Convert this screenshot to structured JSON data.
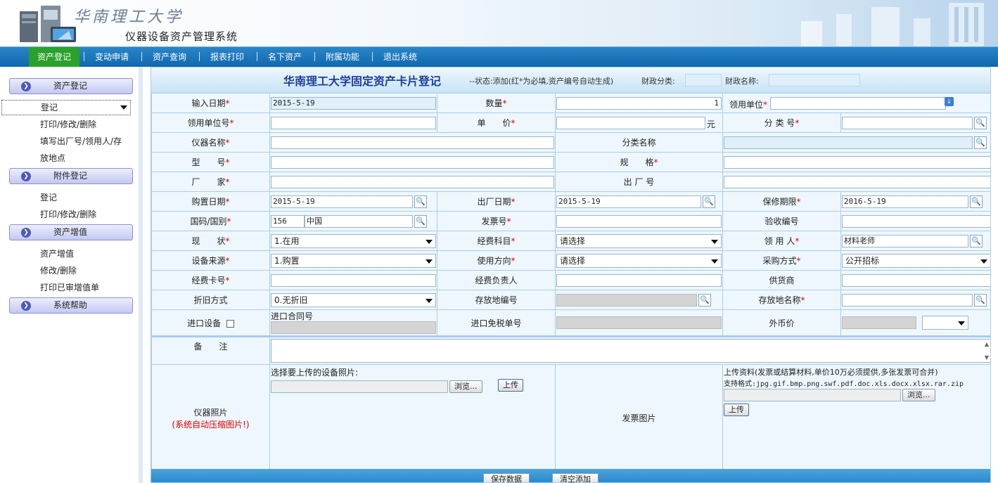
{
  "header": {
    "calligraphy": "华南理工大学",
    "system_title": "仪器设备资产管理系统"
  },
  "nav": {
    "items": [
      "资产登记",
      "变动申请",
      "资产查询",
      "报表打印",
      "名下资产",
      "附属功能",
      "退出系统"
    ],
    "active_color": "#2aa12a",
    "bar_color": "#1a76bb"
  },
  "sidebar": {
    "sections": [
      {
        "title": "资产登记",
        "links": [
          "登记",
          "打印/修改/删除",
          "填写出厂号/领用人/存",
          "放地点"
        ]
      },
      {
        "title": "附件登记",
        "links": [
          "登记",
          "打印/修改/删除"
        ]
      },
      {
        "title": "资产增值",
        "links": [
          "资产增值",
          "修改/删除",
          "打印已审增值单"
        ]
      },
      {
        "title": "系统帮助",
        "links": []
      }
    ]
  },
  "form": {
    "title": "华南理工大学固定资产卡片登记",
    "subtitle": "--状态:添加(红*为必填,资产编号自动生成)",
    "fin_category_label": "财政分类:",
    "fin_name_label": "财政名称:",
    "required_mark": "*",
    "labels": {
      "input_date": "输入日期",
      "quantity": "数量",
      "dept": "领用单位",
      "dept_no": "领用单位号",
      "unit_price": "单　　价",
      "category_no": "分 类 号",
      "instrument_name": "仪器名称",
      "category_name": "分类名称",
      "model": "型　　号",
      "spec": "规　　格",
      "manufacturer": "厂　　家",
      "factory_no": "出 厂 号",
      "purchase_date": "购置日期",
      "factory_date": "出厂日期",
      "warranty": "保修期限",
      "country": "国码/国别",
      "invoice_no": "发票号",
      "acceptance_no": "验收编号",
      "status": "现　　状",
      "fund_subject": "经费科目",
      "user": "领 用 人",
      "source": "设备来源",
      "use_direction": "使用方向",
      "purchase_method": "采购方式",
      "fund_card": "经费卡号",
      "fund_manager": "经费负责人",
      "supplier": "供货商",
      "depreciation": "折旧方式",
      "location_no": "存放地编号",
      "location_name": "存放地名称",
      "imported": "进口设备",
      "import_contract": "进口合同号",
      "tax_exempt": "进口免税单号",
      "foreign_price": "外币价",
      "remarks": "备　　注",
      "photo": "仪器照片",
      "photo_note": "(系统自动压缩图片!)",
      "invoice_image": "发票图片"
    },
    "values": {
      "input_date": "2015-5-19",
      "quantity": "1",
      "unit_price_suffix": "元",
      "purchase_date": "2015-5-19",
      "factory_date": "2015-5-19",
      "warranty": "2016-5-19",
      "country_code": "156",
      "country_name": "中国",
      "status": "1.在用",
      "fund_subject": "请选择",
      "user": "材料老师",
      "source": "1.购置",
      "use_direction": "请选择",
      "purchase_method": "公开招标",
      "depreciation": "0.无折旧"
    },
    "upload": {
      "photo_prompt": "选择要上传的设备照片:",
      "browse": "浏览...",
      "upload": "上传",
      "docs_prompt": "上传资料(发票或结算材料,单价10万必须提供,多张发票可合并)",
      "docs_formats": "支持格式:jpg.gif.bmp.png.swf.pdf.doc.xls.docx.xlsx.rar.zip"
    }
  },
  "bottom": {
    "save": "保存数据",
    "clear": "清空添加"
  }
}
